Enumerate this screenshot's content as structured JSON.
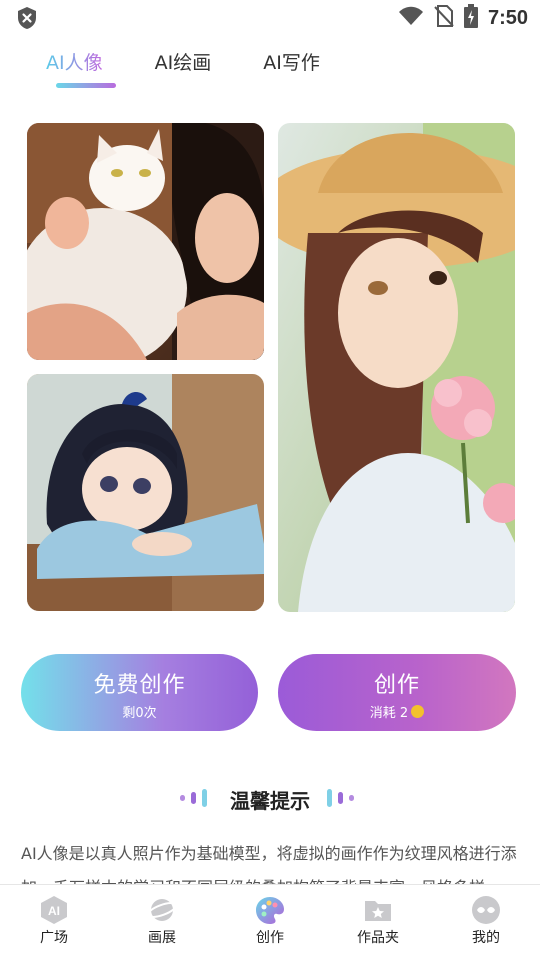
{
  "status": {
    "time": "7:50",
    "icons": [
      "shield-x-icon",
      "wifi-icon",
      "no-sim-icon",
      "battery-charging-icon"
    ]
  },
  "tabs": [
    {
      "label": "AI人像",
      "active": true
    },
    {
      "label": "AI绘画",
      "active": false
    },
    {
      "label": "AI写作",
      "active": false
    }
  ],
  "gallery": [
    {
      "name": "girl-with-cat-before-after"
    },
    {
      "name": "girl-at-desk-before-after"
    },
    {
      "name": "girl-straw-hat-flowers-before-after"
    }
  ],
  "buttons": {
    "free": {
      "label": "免费创作",
      "sub": "剩0次"
    },
    "create": {
      "label": "创作",
      "sub": "消耗 2"
    }
  },
  "tips": {
    "title": "温馨提示",
    "body": "AI人像是以真人照片作为基础模型，将虚拟的画作作为纹理风格进行添加，千万样本的学习和不同层级的叠加构筑了背景丰富、风格多样"
  },
  "nav": [
    {
      "label": "广场",
      "icon": "ai-badge-icon"
    },
    {
      "label": "画展",
      "icon": "planet-icon"
    },
    {
      "label": "创作",
      "icon": "palette-icon",
      "active": true
    },
    {
      "label": "作品夹",
      "icon": "folder-star-icon"
    },
    {
      "label": "我的",
      "icon": "profile-mask-icon"
    }
  ],
  "colors": {
    "accent_start": "#6ad7e8",
    "accent_end": "#b96bde"
  }
}
